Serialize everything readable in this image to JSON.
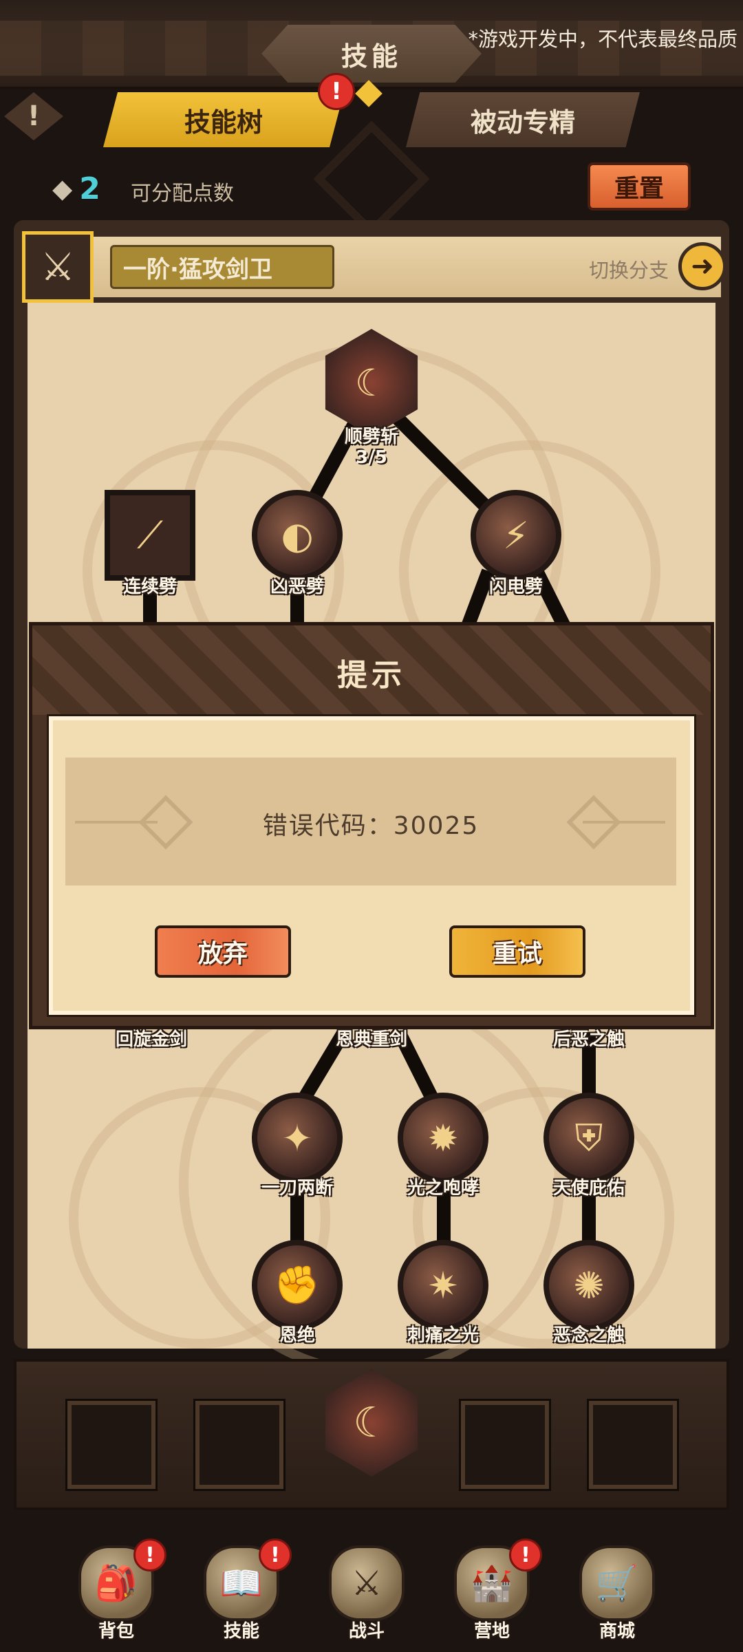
{
  "header": {
    "title": "技能",
    "dev_notice": "*游戏开发中，不代表最终品质",
    "alert_icon": "!",
    "tabs": [
      {
        "label": "技能树",
        "active": true,
        "badge": "!"
      },
      {
        "label": "被动专精",
        "active": false
      }
    ]
  },
  "points": {
    "value": "2",
    "label": "可分配点数",
    "reset_label": "重置"
  },
  "branch": {
    "name": "一阶·猛攻剑卫",
    "switch_label": "切换分支"
  },
  "skills": {
    "root": {
      "name": "顺劈斩",
      "level": "3/5"
    },
    "row2": [
      "连续劈",
      "凶恶劈",
      "闪电劈"
    ],
    "row3_partial": [
      "回旋金剑",
      "恩典重剑",
      "后恶之触"
    ],
    "row4": [
      "一刀两断",
      "光之咆哮",
      "天使庇佑"
    ],
    "row5": [
      "恩绝",
      "刺痛之光",
      "恶念之触"
    ]
  },
  "dialog": {
    "title": "提示",
    "message": "错误代码：30025",
    "give_up_label": "放弃",
    "retry_label": "重试"
  },
  "nav": [
    {
      "label": "背包",
      "icon": "backpack-icon",
      "badge": "!"
    },
    {
      "label": "技能",
      "icon": "skill-book-icon",
      "badge": "!"
    },
    {
      "label": "战斗",
      "icon": "battle-icon",
      "badge": ""
    },
    {
      "label": "营地",
      "icon": "camp-castle-icon",
      "badge": "!"
    },
    {
      "label": "商城",
      "icon": "shop-icon",
      "badge": ""
    }
  ],
  "colors": {
    "accent_gold": "#f2c23a",
    "accent_orange": "#e4653a",
    "points_cyan": "#4fd0d8",
    "badge_red": "#e0322a"
  }
}
